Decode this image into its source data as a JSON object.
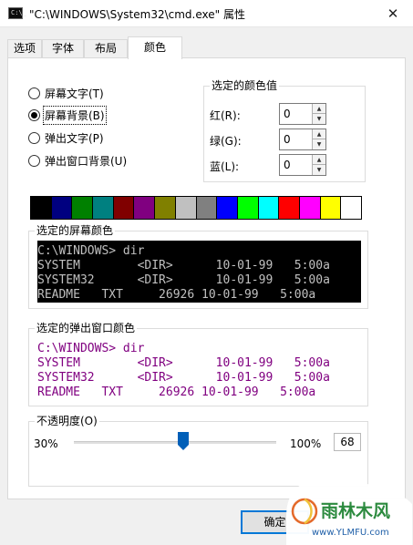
{
  "window": {
    "title": "\"C:\\WINDOWS\\System32\\cmd.exe\" 属性",
    "icon_text": "C:\\_",
    "close_glyph": "✕"
  },
  "tabs": [
    {
      "label": "选项",
      "active": false
    },
    {
      "label": "字体",
      "active": false
    },
    {
      "label": "布局",
      "active": false
    },
    {
      "label": "颜色",
      "active": true
    }
  ],
  "radios": [
    {
      "label": "屏幕文字(T)",
      "checked": false
    },
    {
      "label": "屏幕背景(B)",
      "checked": true
    },
    {
      "label": "弹出文字(P)",
      "checked": false
    },
    {
      "label": "弹出窗口背景(U)",
      "checked": false
    }
  ],
  "selected_color": {
    "title": "选定的颜色值",
    "red_label": "红(R):",
    "red_value": "0",
    "green_label": "绿(G):",
    "green_value": "0",
    "blue_label": "蓝(L):",
    "blue_value": "0"
  },
  "palette": [
    "#000000",
    "#000080",
    "#008000",
    "#008080",
    "#800000",
    "#800080",
    "#808000",
    "#c0c0c0",
    "#808080",
    "#0000ff",
    "#00ff00",
    "#00ffff",
    "#ff0000",
    "#ff00ff",
    "#ffff00",
    "#ffffff"
  ],
  "screen_preview": {
    "title": "选定的屏幕颜色",
    "lines": [
      "C:\\WINDOWS> dir",
      "SYSTEM        <DIR>      10-01-99   5:00a",
      "SYSTEM32      <DIR>      10-01-99   5:00a",
      "README   TXT     26926 10-01-99   5:00a"
    ],
    "fg": "#c0c0c0",
    "bg": "#000000"
  },
  "popup_preview": {
    "title": "选定的弹出窗口颜色",
    "lines": [
      "C:\\WINDOWS> dir",
      "SYSTEM        <DIR>      10-01-99   5:00a",
      "SYSTEM32      <DIR>      10-01-99   5:00a",
      "README   TXT     26926 10-01-99   5:00a"
    ],
    "fg": "#800080",
    "bg": "#ffffff"
  },
  "opacity": {
    "title": "不透明度(O)",
    "min_label": "30%",
    "max_label": "100%",
    "value": "68"
  },
  "buttons": {
    "ok_label": "确定"
  },
  "watermark": {
    "brand": "雨林木风",
    "url": "www.YLMFU.com"
  }
}
